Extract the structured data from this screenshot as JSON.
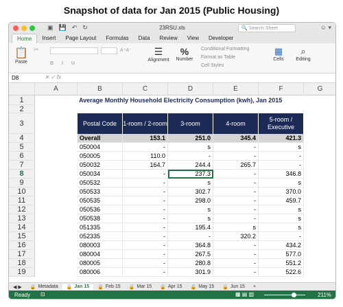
{
  "page_title": "Snapshot of data for Jan 2015 (Public Housing)",
  "colors": {
    "header_navy": "#1c2a56",
    "accent_green": "#217346",
    "close": "#fd5f57",
    "minimize": "#fdbc2e",
    "maximize": "#29c840"
  },
  "window": {
    "filename": "23RSU.xls",
    "search_placeholder": "Search Sheet"
  },
  "ribbon_tabs": [
    "Home",
    "Insert",
    "Page Layout",
    "Formulas",
    "Data",
    "Review",
    "View",
    "Developer"
  ],
  "ribbon": {
    "paste": "Paste",
    "alignment": "Alignment",
    "number": "Number",
    "percent": "%",
    "conditional": "Conditional Formatting",
    "format_table": "Format as Table",
    "cell_styles": "Cell Styles",
    "cells": "Cells",
    "editing": "Editing"
  },
  "formula_bar": {
    "name_box": "D8",
    "fx": "fx"
  },
  "columns": [
    "A",
    "B",
    "C",
    "D",
    "E",
    "F",
    "G"
  ],
  "title_text": "Average Monthly Household Electricity Consumption (kwh), Jan 2015",
  "table_headers": [
    "Postal Code",
    "1-room / 2-room",
    "3-room",
    "4-room",
    "5-room / Executive"
  ],
  "row_numbers": [
    "1",
    "2",
    "3",
    "4",
    "5",
    "6",
    "7",
    "8",
    "9",
    "10",
    "11",
    "12",
    "13",
    "14",
    "15",
    "16",
    "17",
    "18",
    "19"
  ],
  "rows": [
    [
      "Overall",
      "153.1",
      "251.0",
      "345.4",
      "421.3"
    ],
    [
      "050004",
      "-",
      "s",
      "-",
      "s"
    ],
    [
      "050005",
      "110.0",
      "-",
      "-",
      "-"
    ],
    [
      "050032",
      "164.7",
      "244.4",
      "265.7",
      "-"
    ],
    [
      "050034",
      "-",
      "237.3",
      "-",
      "346.8"
    ],
    [
      "050532",
      "-",
      "s",
      "-",
      "s"
    ],
    [
      "050533",
      "-",
      "302.7",
      "-",
      "370.0"
    ],
    [
      "050535",
      "-",
      "298.0",
      "-",
      "459.7"
    ],
    [
      "050536",
      "-",
      "s",
      "-",
      "s"
    ],
    [
      "050538",
      "-",
      "s",
      "-",
      "s"
    ],
    [
      "051335",
      "-",
      "195.4",
      "s",
      "s"
    ],
    [
      "052335",
      "-",
      "-",
      "320.2",
      "-"
    ],
    [
      "080003",
      "-",
      "364.8",
      "-",
      "434.2"
    ],
    [
      "080004",
      "-",
      "267.5",
      "-",
      "577.0"
    ],
    [
      "080005",
      "-",
      "280.8",
      "-",
      "551.2"
    ],
    [
      "080006",
      "-",
      "301.9",
      "-",
      "522.6"
    ]
  ],
  "sheet_tabs": [
    "Metadata",
    "Jan 15",
    "Feb 15",
    "Mar 15",
    "Apr 15",
    "May 15",
    "Jun 15"
  ],
  "active_sheet": "Jan 15",
  "status": {
    "ready": "Ready",
    "zoom": "211%"
  }
}
